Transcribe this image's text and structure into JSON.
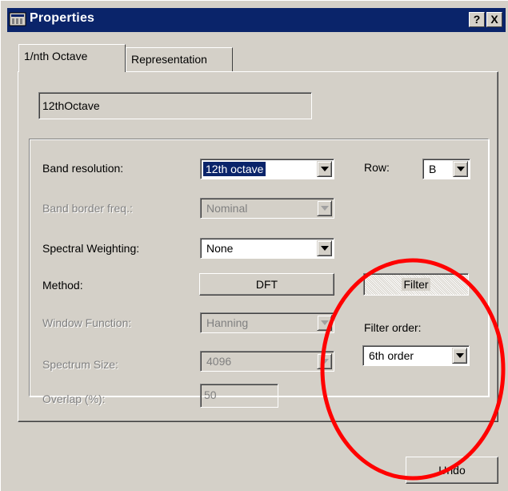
{
  "window": {
    "title": "Properties",
    "help_button": "?",
    "close_button": "X"
  },
  "tabs": [
    {
      "label": "1/nth Octave",
      "active": true
    },
    {
      "label": "Representation",
      "active": false
    }
  ],
  "name_field": {
    "value": "12thOctave"
  },
  "form": {
    "band_resolution": {
      "label": "Band resolution:",
      "value": "12th octave",
      "enabled": true
    },
    "band_border_freq": {
      "label": "Band border freq.:",
      "value": "Nominal",
      "enabled": false
    },
    "spectral_weighting": {
      "label": "Spectral Weighting:",
      "value": "None",
      "enabled": true
    },
    "method": {
      "label": "Method:",
      "dft_label": "DFT",
      "filter_label": "Filter"
    },
    "window_function": {
      "label": "Window Function:",
      "value": "Hanning",
      "enabled": false
    },
    "spectrum_size": {
      "label": "Spectrum Size:",
      "value": "4096",
      "enabled": false
    },
    "overlap": {
      "label": "Overlap (%):",
      "value": "50",
      "enabled": false
    },
    "row": {
      "label": "Row:",
      "value": "B"
    },
    "filter_order": {
      "label": "Filter order:",
      "value": "6th order"
    }
  },
  "footer": {
    "undo_label": "Undo"
  },
  "annotation": {
    "color": "#ff0000",
    "shape": "ellipse"
  }
}
